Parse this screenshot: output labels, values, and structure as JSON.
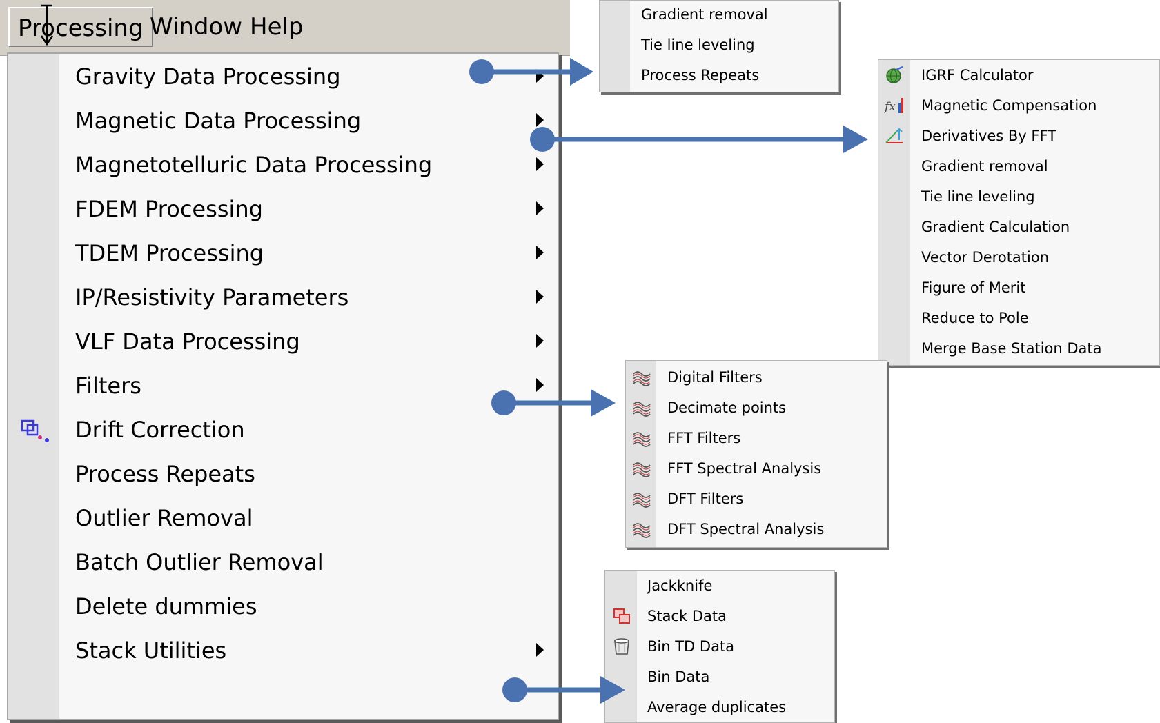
{
  "menubar": {
    "items": [
      {
        "label": "Processing"
      },
      {
        "label": "Window"
      },
      {
        "label": "Help"
      }
    ]
  },
  "main_menu": {
    "items": [
      {
        "label": "Gravity Data Processing",
        "has_submenu": true
      },
      {
        "label": "Magnetic Data Processing",
        "has_submenu": true
      },
      {
        "label": "Magnetotelluric Data Processing",
        "has_submenu": true
      },
      {
        "label": "FDEM Processing",
        "has_submenu": true
      },
      {
        "label": "TDEM Processing",
        "has_submenu": true
      },
      {
        "label": "IP/Resistivity Parameters",
        "has_submenu": true
      },
      {
        "label": "VLF Data Processing",
        "has_submenu": true
      },
      {
        "label": "Filters",
        "has_submenu": true
      },
      {
        "label": "Drift Correction",
        "icon": "drift-correction-icon"
      },
      {
        "label": "Process Repeats"
      },
      {
        "label": "Outlier Removal"
      },
      {
        "label": "Batch Outlier Removal"
      },
      {
        "label": "Delete dummies"
      },
      {
        "label": "Stack Utilities",
        "has_submenu": true
      }
    ]
  },
  "gravity_submenu": {
    "items": [
      {
        "label": "Gradient removal"
      },
      {
        "label": "Tie line leveling"
      },
      {
        "label": "Process Repeats"
      }
    ]
  },
  "magnetic_submenu": {
    "items": [
      {
        "label": "IGRF Calculator",
        "icon": "globe-icon"
      },
      {
        "label": "Magnetic Compensation",
        "icon": "function-icon"
      },
      {
        "label": "Derivatives By FFT",
        "icon": "derivative-icon"
      },
      {
        "label": "Gradient removal"
      },
      {
        "label": "Tie line leveling"
      },
      {
        "label": "Gradient Calculation"
      },
      {
        "label": "Vector Derotation"
      },
      {
        "label": "Figure of Merit"
      },
      {
        "label": "Reduce to Pole"
      },
      {
        "label": "Merge Base Station Data"
      }
    ]
  },
  "filters_submenu": {
    "items": [
      {
        "label": "Digital Filters",
        "icon": "wave-filter-icon"
      },
      {
        "label": "Decimate points",
        "icon": "wave-filter-icon"
      },
      {
        "label": "FFT Filters",
        "icon": "wave-filter-icon"
      },
      {
        "label": "FFT Spectral Analysis",
        "icon": "wave-filter-icon"
      },
      {
        "label": "DFT Filters",
        "icon": "wave-filter-icon"
      },
      {
        "label": "DFT Spectral Analysis",
        "icon": "wave-filter-icon"
      }
    ]
  },
  "stack_submenu": {
    "items": [
      {
        "label": "Jackknife"
      },
      {
        "label": "Stack Data",
        "icon": "stack-icon"
      },
      {
        "label": "Bin TD Data",
        "icon": "bin-icon"
      },
      {
        "label": "Bin Data"
      },
      {
        "label": "Average duplicates"
      }
    ]
  },
  "colors": {
    "menubar": "#d4d0c8",
    "menu_bg": "#f7f7f7",
    "gutter": "#e2e2e2",
    "callout_arrow": "#4a72b0"
  }
}
